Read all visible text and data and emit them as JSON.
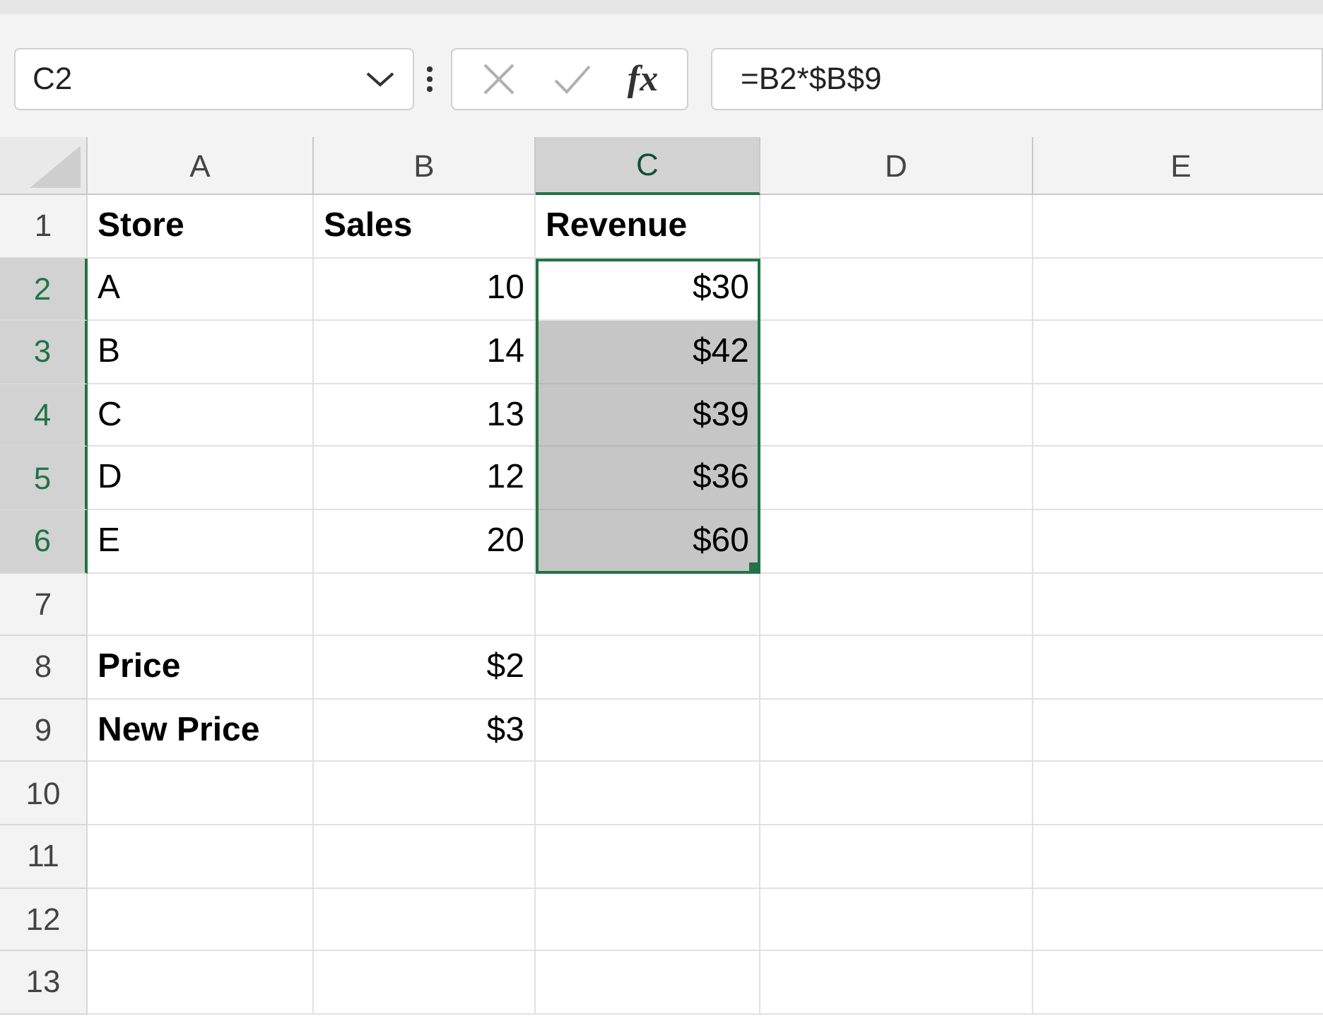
{
  "name_box": {
    "value": "C2"
  },
  "formula_bar": {
    "function_label": "fx",
    "formula": "=B2*$B$9"
  },
  "columns": [
    {
      "label": "A",
      "selected": false
    },
    {
      "label": "B",
      "selected": false
    },
    {
      "label": "C",
      "selected": true
    },
    {
      "label": "D",
      "selected": false
    },
    {
      "label": "E",
      "selected": false
    }
  ],
  "rows": [
    {
      "header": "1",
      "selected": false,
      "column_a": {
        "text": "Store",
        "bold": true,
        "kind": "text",
        "selected": false
      },
      "column_b": {
        "text": "Sales",
        "bold": true,
        "kind": "text",
        "selected": false
      },
      "column_c": {
        "text": "Revenue",
        "bold": true,
        "kind": "text",
        "selected": false
      }
    },
    {
      "header": "2",
      "selected": true,
      "column_a": {
        "text": "A",
        "bold": false,
        "kind": "text",
        "selected": false
      },
      "column_b": {
        "text": "10",
        "bold": false,
        "kind": "number",
        "selected": false
      },
      "column_c": {
        "text": "$30",
        "bold": false,
        "kind": "number",
        "selected": true,
        "active": true
      }
    },
    {
      "header": "3",
      "selected": true,
      "column_a": {
        "text": "B",
        "bold": false,
        "kind": "text",
        "selected": false
      },
      "column_b": {
        "text": "14",
        "bold": false,
        "kind": "number",
        "selected": false
      },
      "column_c": {
        "text": "$42",
        "bold": false,
        "kind": "number",
        "selected": true,
        "active": false
      }
    },
    {
      "header": "4",
      "selected": true,
      "column_a": {
        "text": "C",
        "bold": false,
        "kind": "text",
        "selected": false
      },
      "column_b": {
        "text": "13",
        "bold": false,
        "kind": "number",
        "selected": false
      },
      "column_c": {
        "text": "$39",
        "bold": false,
        "kind": "number",
        "selected": true,
        "active": false
      }
    },
    {
      "header": "5",
      "selected": true,
      "column_a": {
        "text": "D",
        "bold": false,
        "kind": "text",
        "selected": false
      },
      "column_b": {
        "text": "12",
        "bold": false,
        "kind": "number",
        "selected": false
      },
      "column_c": {
        "text": "$36",
        "bold": false,
        "kind": "number",
        "selected": true,
        "active": false
      }
    },
    {
      "header": "6",
      "selected": true,
      "column_a": {
        "text": "E",
        "bold": false,
        "kind": "text",
        "selected": false
      },
      "column_b": {
        "text": "20",
        "bold": false,
        "kind": "number",
        "selected": false
      },
      "column_c": {
        "text": "$60",
        "bold": false,
        "kind": "number",
        "selected": true,
        "active": false
      }
    },
    {
      "header": "7",
      "selected": false
    },
    {
      "header": "8",
      "selected": false,
      "column_a": {
        "text": "Price",
        "bold": true,
        "kind": "text",
        "selected": false
      },
      "column_b": {
        "text": "$2",
        "bold": false,
        "kind": "number",
        "selected": false
      }
    },
    {
      "header": "9",
      "selected": false,
      "column_a": {
        "text": "New Price",
        "bold": true,
        "kind": "text",
        "selected": false
      },
      "column_b": {
        "text": "$3",
        "bold": false,
        "kind": "number",
        "selected": false
      }
    },
    {
      "header": "10",
      "selected": false
    },
    {
      "header": "11",
      "selected": false
    },
    {
      "header": "12",
      "selected": false
    },
    {
      "header": "13",
      "selected": false
    }
  ]
}
